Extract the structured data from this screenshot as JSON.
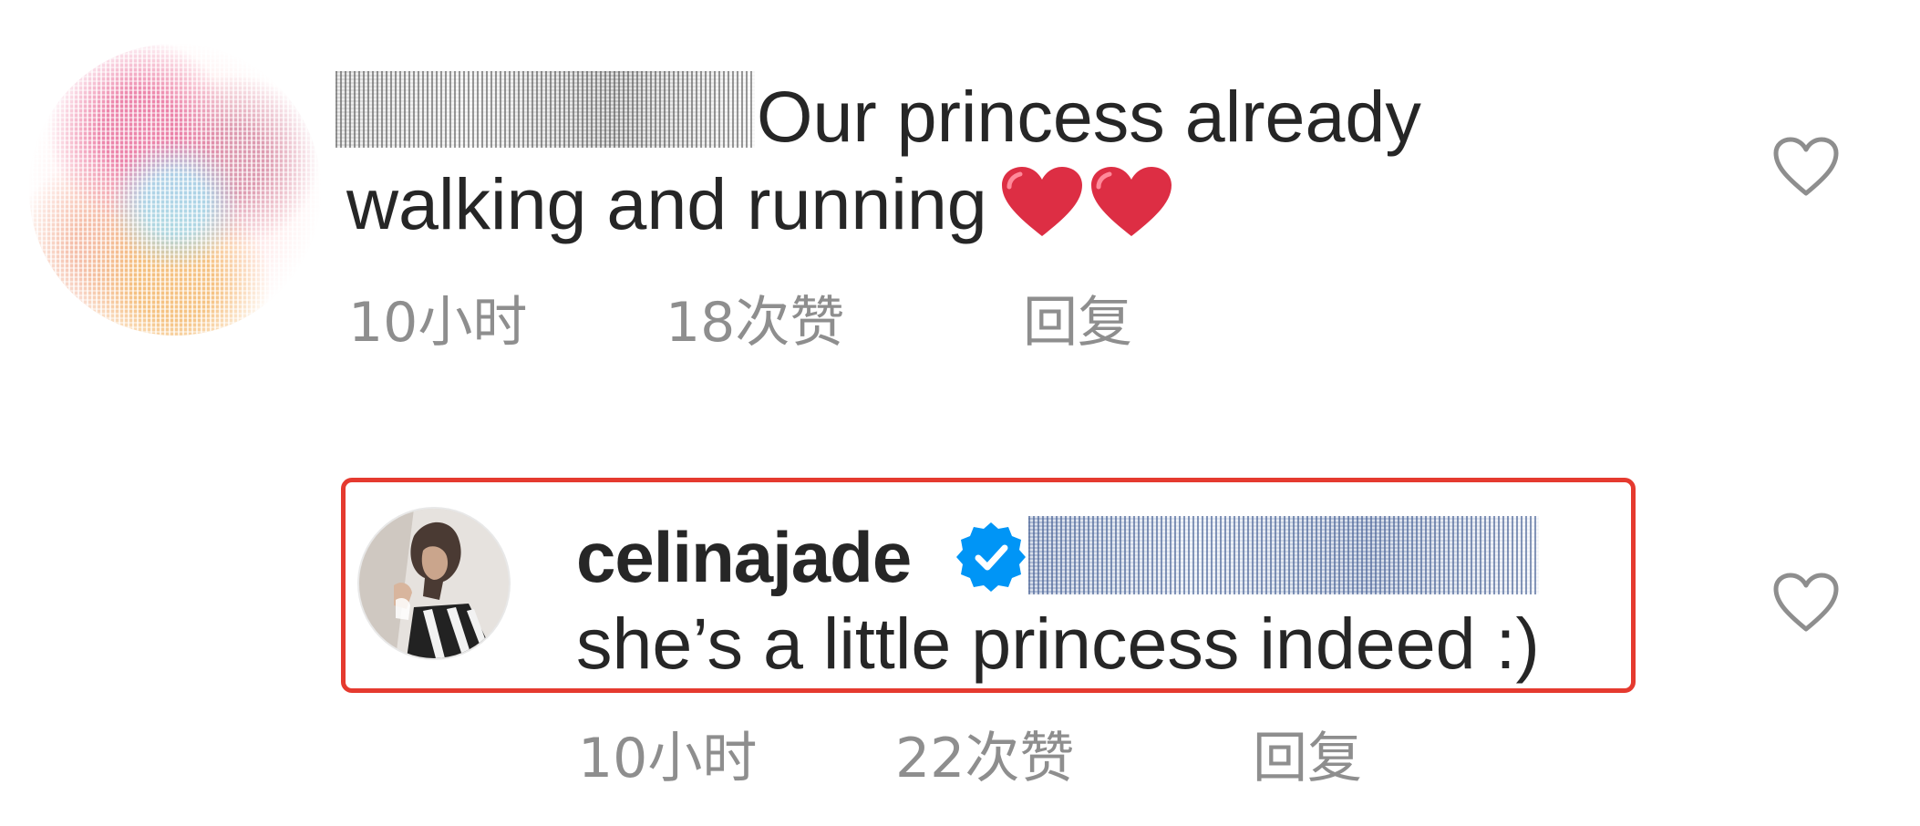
{
  "comments": [
    {
      "text_line1": "Our princess already",
      "text_line2": "walking and running",
      "emoji": "❤️❤️",
      "time": "10小时",
      "likes": "18次赞",
      "reply_label": "回复"
    },
    {
      "username": "celinajade",
      "verified": true,
      "text": "she’s a little princess indeed :)",
      "time": "10小时",
      "likes": "22次赞",
      "reply_label": "回复"
    }
  ],
  "icons": {
    "like": "heart-outline-icon",
    "verified": "verified-badge-icon",
    "emoji": "red-heart-emoji"
  },
  "colors": {
    "text": "#262626",
    "meta": "#8e8e8e",
    "verified": "#0095f6",
    "highlight": "#e53a2f",
    "emoji_heart": "#dd2e44"
  }
}
